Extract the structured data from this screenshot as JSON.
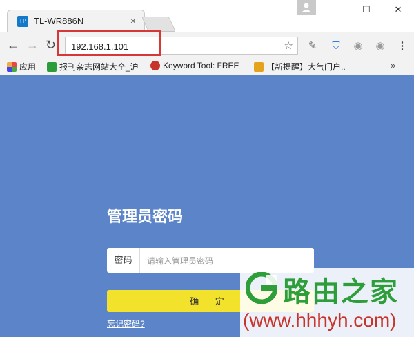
{
  "browser": {
    "tab": {
      "favicon_text": "TP",
      "title": "TL-WR886N",
      "close": "×"
    },
    "window_buttons": {
      "minimize": "—",
      "maximize": "☐",
      "close": "✕"
    },
    "address_bar": {
      "url": "192.168.1.101"
    },
    "bookmarks": [
      {
        "label": "应用",
        "icon": "apps-icon"
      },
      {
        "label": "报刊杂志网站大全_沪",
        "icon": "bookmark-icon"
      },
      {
        "label": "Keyword Tool: FREE",
        "icon": "bookmark-icon"
      },
      {
        "label": "【新提醒】大气门户..",
        "icon": "bookmark-icon"
      }
    ],
    "bookmarks_more": "»"
  },
  "login": {
    "title": "管理员密码",
    "password_label": "密码",
    "password_placeholder": "请输入管理员密码",
    "confirm_label": "确 定",
    "forgot_link": "忘记密码?"
  },
  "watermark": {
    "brand": "路由之家",
    "url": "(www.hhhyh.com)"
  },
  "colors": {
    "page_background": "#5b85c8",
    "confirm_button": "#f2e22b",
    "highlight_box": "#d63838",
    "watermark_green": "#2e9e3a",
    "watermark_red": "#c9342a"
  }
}
